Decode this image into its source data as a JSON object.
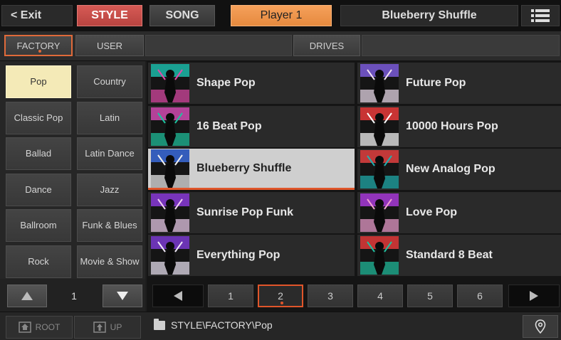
{
  "topbar": {
    "exit_label": "< Exit",
    "style_tab": "STYLE",
    "song_tab": "SONG",
    "player_label": "Player 1",
    "current_style": "Blueberry Shuffle",
    "menu_icon": "list-menu-icon"
  },
  "sources": {
    "factory": "FACTORY",
    "user": "USER",
    "drives": "DRIVES"
  },
  "categories": [
    {
      "label": "Pop",
      "selected": true
    },
    {
      "label": "Country"
    },
    {
      "label": "Classic Pop"
    },
    {
      "label": "Latin"
    },
    {
      "label": "Ballad"
    },
    {
      "label": "Latin Dance"
    },
    {
      "label": "Dance"
    },
    {
      "label": "Jazz"
    },
    {
      "label": "Ballroom"
    },
    {
      "label": "Funk & Blues"
    },
    {
      "label": "Rock"
    },
    {
      "label": "Movie & Show"
    }
  ],
  "category_page": "1",
  "styles": [
    {
      "name": "Shape Pop",
      "thumb": [
        "#1bb8a8",
        "#e04aa8"
      ]
    },
    {
      "name": "Future Pop",
      "thumb": [
        "#7a5ad8",
        "#f0e0f0"
      ]
    },
    {
      "name": "16 Beat Pop",
      "thumb": [
        "#d04ab0",
        "#1ec4a0"
      ]
    },
    {
      "name": "10000 Hours Pop",
      "thumb": [
        "#e83a3a",
        "#ffffff"
      ]
    },
    {
      "name": "Blueberry Shuffle",
      "thumb": [
        "#3a6ad8",
        "#f0f0f0"
      ],
      "selected": true
    },
    {
      "name": "New Analog Pop",
      "thumb": [
        "#e04040",
        "#20b0b0"
      ]
    },
    {
      "name": "Sunrise Pop Funk",
      "thumb": [
        "#8a3ad8",
        "#f0d0f0"
      ]
    },
    {
      "name": "Love Pop",
      "thumb": [
        "#a83ad8",
        "#f0a0d0"
      ]
    },
    {
      "name": "Everything Pop",
      "thumb": [
        "#7a3ad0",
        "#f0e8f8"
      ]
    },
    {
      "name": "Standard 8 Beat",
      "thumb": [
        "#e03a3a",
        "#20c0a0"
      ]
    }
  ],
  "pages": [
    "1",
    "2",
    "3",
    "4",
    "5",
    "6"
  ],
  "current_page": "2",
  "footer": {
    "root_label": "ROOT",
    "up_label": "UP",
    "path": "STYLE\\FACTORY\\Pop"
  },
  "colors": {
    "accent_orange": "#e0552a",
    "style_tab_red": "#c94a45",
    "player_orange": "#f29a50",
    "selected_category": "#f4eab7"
  }
}
